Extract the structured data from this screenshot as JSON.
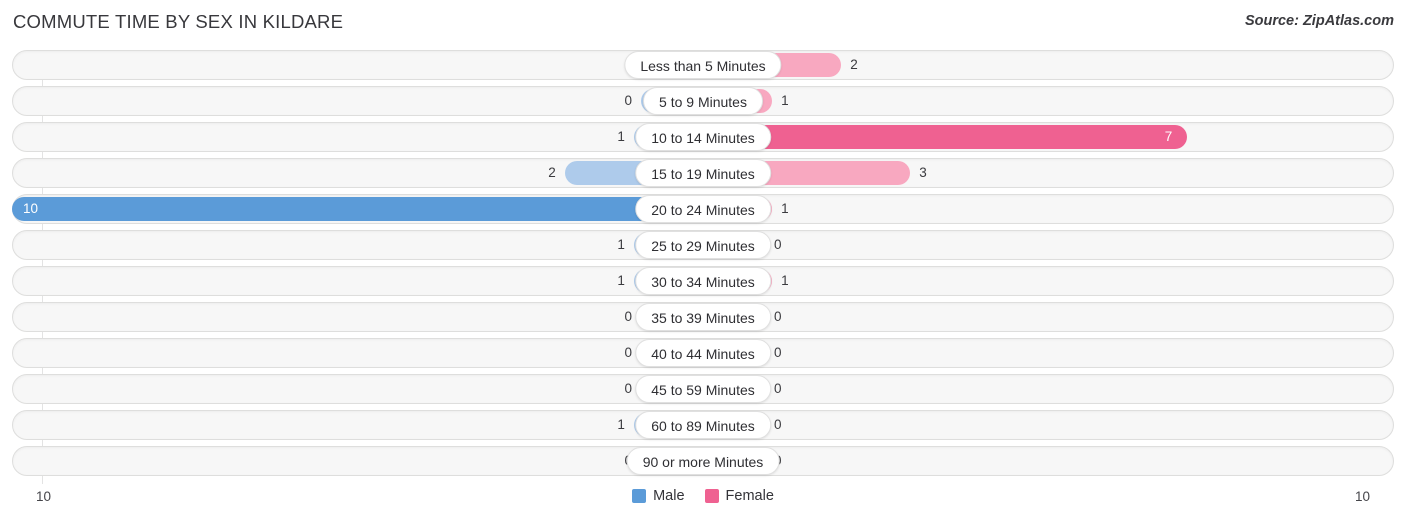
{
  "header": {
    "title": "COMMUTE TIME BY SEX IN KILDARE",
    "source": "Source: ZipAtlas.com"
  },
  "axis": {
    "left_end": "10",
    "right_end": "10"
  },
  "legend": {
    "items": [
      {
        "label": "Male",
        "color": "#5b9bd8"
      },
      {
        "label": "Female",
        "color": "#ef6191"
      }
    ]
  },
  "colors": {
    "male_strong": "#5b9bd8",
    "male_light": "#aecbeb",
    "female_strong": "#ef6191",
    "female_light": "#f8a8c0",
    "track": "#f7f7f7",
    "track_border": "#dededd"
  },
  "chart_data": {
    "type": "bar",
    "title": "COMMUTE TIME BY SEX IN KILDARE",
    "subtitle": "Source: ZipAtlas.com",
    "orientation": "horizontal",
    "style": "diverging-bidirectional",
    "xlabel": "",
    "ylabel": "",
    "xlim": [
      -10,
      10
    ],
    "axis_tick_labels": [
      "10",
      "10"
    ],
    "grid": false,
    "legend_position": "bottom-center",
    "categories": [
      "Less than 5 Minutes",
      "5 to 9 Minutes",
      "10 to 14 Minutes",
      "15 to 19 Minutes",
      "20 to 24 Minutes",
      "25 to 29 Minutes",
      "30 to 34 Minutes",
      "35 to 39 Minutes",
      "40 to 44 Minutes",
      "45 to 59 Minutes",
      "60 to 89 Minutes",
      "90 or more Minutes"
    ],
    "series": [
      {
        "name": "Male",
        "values": [
          0,
          0,
          1,
          2,
          10,
          1,
          1,
          0,
          0,
          0,
          1,
          0
        ]
      },
      {
        "name": "Female",
        "values": [
          2,
          1,
          7,
          3,
          1,
          0,
          1,
          0,
          0,
          0,
          0,
          0
        ]
      }
    ]
  },
  "rows": [
    {
      "category": "Less than 5 Minutes",
      "male": "0",
      "female": "2"
    },
    {
      "category": "5 to 9 Minutes",
      "male": "0",
      "female": "1"
    },
    {
      "category": "10 to 14 Minutes",
      "male": "1",
      "female": "7"
    },
    {
      "category": "15 to 19 Minutes",
      "male": "2",
      "female": "3"
    },
    {
      "category": "20 to 24 Minutes",
      "male": "10",
      "female": "1"
    },
    {
      "category": "25 to 29 Minutes",
      "male": "1",
      "female": "0"
    },
    {
      "category": "30 to 34 Minutes",
      "male": "1",
      "female": "1"
    },
    {
      "category": "35 to 39 Minutes",
      "male": "0",
      "female": "0"
    },
    {
      "category": "40 to 44 Minutes",
      "male": "0",
      "female": "0"
    },
    {
      "category": "45 to 59 Minutes",
      "male": "0",
      "female": "0"
    },
    {
      "category": "60 to 89 Minutes",
      "male": "1",
      "female": "0"
    },
    {
      "category": "90 or more Minutes",
      "male": "0",
      "female": "0"
    }
  ]
}
